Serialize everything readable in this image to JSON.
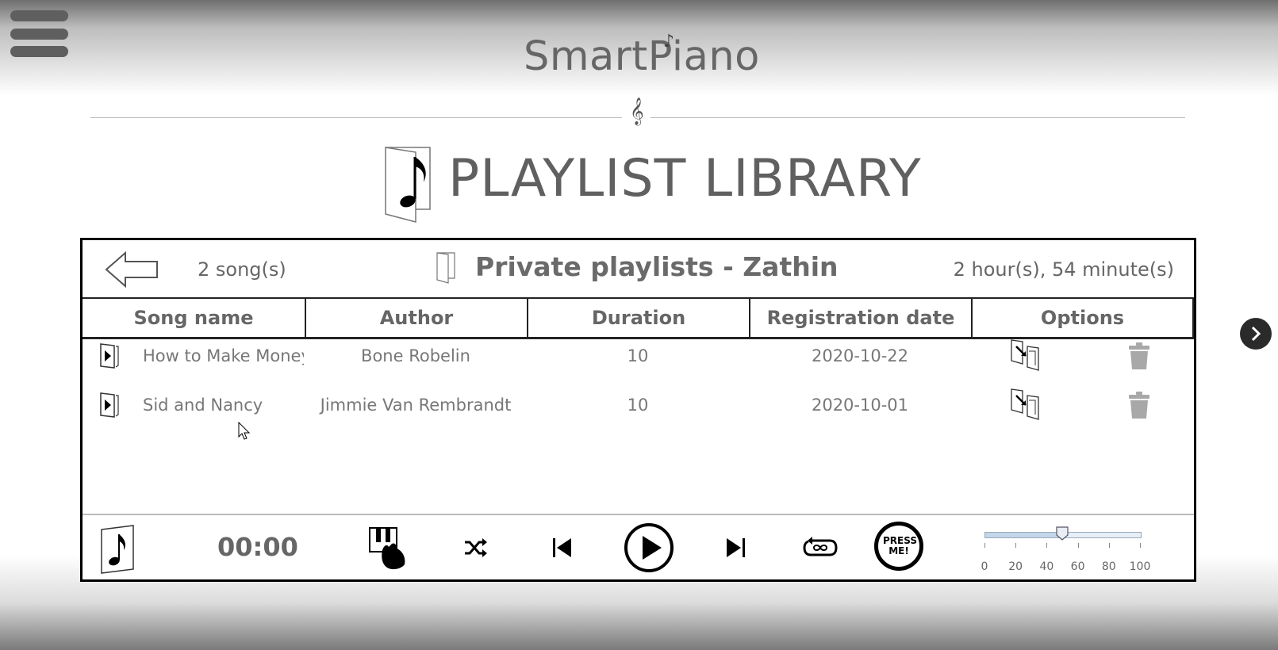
{
  "app": {
    "brand": "SmartPiano",
    "page_title": "PLAYLIST LIBRARY"
  },
  "playlist": {
    "song_count": "2 song(s)",
    "name": "Private playlists - Zathin",
    "total_duration": "2 hour(s), 54 minute(s)"
  },
  "table": {
    "columns": [
      "Song name",
      "Author",
      "Duration",
      "Registration date",
      "Options"
    ],
    "rows": [
      {
        "song": "How to Make Money S",
        "author": "Bone Robelin",
        "duration": "10",
        "date": "2020-10-22"
      },
      {
        "song": "Sid and Nancy",
        "author": "Jimmie Van Rembrandt",
        "duration": "10",
        "date": "2020-10-01"
      }
    ]
  },
  "player": {
    "time": "00:00",
    "press_me_label": "PRESS ME!",
    "volume": {
      "value": 50,
      "min": 0,
      "max": 100,
      "tick_labels": [
        "0",
        "20",
        "40",
        "60",
        "80",
        "100"
      ]
    }
  },
  "icons": {
    "menu": "hamburger-menu-icon",
    "back": "back-arrow-icon",
    "playlist": "playlist-folder-icon",
    "row_play": "play-song-icon",
    "move": "move-to-playlist-icon",
    "delete": "trash-icon",
    "now_playing": "music-note-icon",
    "piano_mode": "piano-hand-icon",
    "shuffle": "shuffle-icon",
    "previous": "skip-previous-icon",
    "play": "play-circle-icon",
    "next": "skip-next-icon",
    "repeat": "repeat-infinity-icon",
    "next_page": "chevron-right-icon"
  },
  "colors": {
    "text": "#666666",
    "border": "#000000",
    "side_button": "#2a2a2a"
  }
}
